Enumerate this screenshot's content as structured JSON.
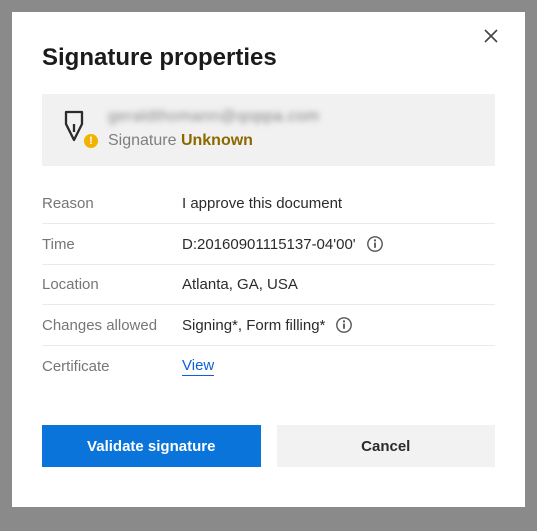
{
  "dialog": {
    "title": "Signature properties"
  },
  "signer": {
    "email_blurred": "geraldthomann@q",
    "email_clear_suffix": "oppa.com",
    "signature_label": "Signature",
    "status": "Unknown",
    "badge_glyph": "!"
  },
  "rows": {
    "reason": {
      "label": "Reason",
      "value": "I approve this document"
    },
    "time": {
      "label": "Time",
      "value": "D:20160901115137-04'00'"
    },
    "location": {
      "label": "Location",
      "value": "Atlanta, GA, USA"
    },
    "changes": {
      "label": "Changes allowed",
      "value": "Signing*, Form filling*"
    },
    "certificate": {
      "label": "Certificate",
      "link": "View"
    }
  },
  "buttons": {
    "validate": "Validate signature",
    "cancel": "Cancel"
  }
}
